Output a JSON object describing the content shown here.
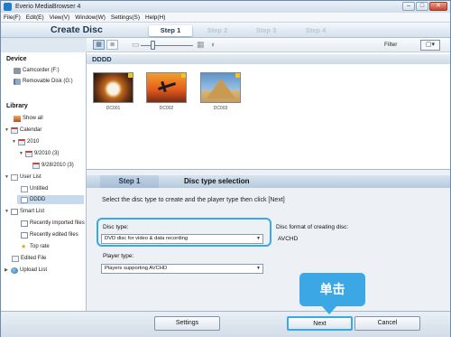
{
  "window": {
    "title": "Everio MediaBrowser 4",
    "minimize_glyph": "–",
    "maximize_glyph": "□",
    "close_glyph": "✕"
  },
  "menu": [
    "File(F)",
    "Edit(E)",
    "View(V)",
    "Window(W)",
    "Settings(S)",
    "Help(H)"
  ],
  "header": {
    "mode_title": "Create Disc",
    "steps": [
      "Step 1",
      "Step 2",
      "Step 3",
      "Step 4"
    ],
    "active_step": 0
  },
  "toolbar": {
    "filter_label": "Filter",
    "filter_button_glyph": "▢▾",
    "view_mode_glyphs": [
      "▦",
      "≣"
    ],
    "zoom_glyphs": [
      "▭",
      "▦"
    ],
    "extra_glyph": "◐"
  },
  "sidebar": {
    "device_heading": "Device",
    "devices": [
      "Camcorder (F:)",
      "Removable Disk (G:)"
    ],
    "library_heading": "Library",
    "library": {
      "showall": "Show all",
      "calendar": "Calendar",
      "year": "2010",
      "month": "9/2010 (3)",
      "day": "9/28/2010 (3)",
      "user_list": "User List",
      "untitled": "Untitled",
      "dddd": "DDDD",
      "smart_list": "Smart List",
      "recently_imported": "Recently imported files",
      "recently_edited": "Recently edited files",
      "top_rate": "Top rate",
      "edited_file": "Edited File",
      "upload_list": "Upload List"
    },
    "expander_open": "▼",
    "expander_closed": "▶"
  },
  "content": {
    "album_title": "DDDD",
    "thumbnails": [
      {
        "label": "DC001"
      },
      {
        "label": "DC002"
      },
      {
        "label": "DC003"
      }
    ]
  },
  "panel": {
    "step_label": "Step 1",
    "step_name": "Disc type selection",
    "instruction": "Select the disc type to create and the player type then click [Next]",
    "disc_type_label": "Disc type:",
    "disc_type_value": "DVD disc for video & data recording",
    "player_type_label": "Player type:",
    "player_type_value": "Players supporting AVCHD",
    "format_label": "Disc format of creating disc:",
    "format_value": "AVCHD",
    "dropdown_arrow": "▼"
  },
  "callout": {
    "text": "单击",
    "color": "#3ba8e5"
  },
  "footer": {
    "settings_label": "Settings",
    "next_label": "Next",
    "cancel_label": "Cancel"
  }
}
